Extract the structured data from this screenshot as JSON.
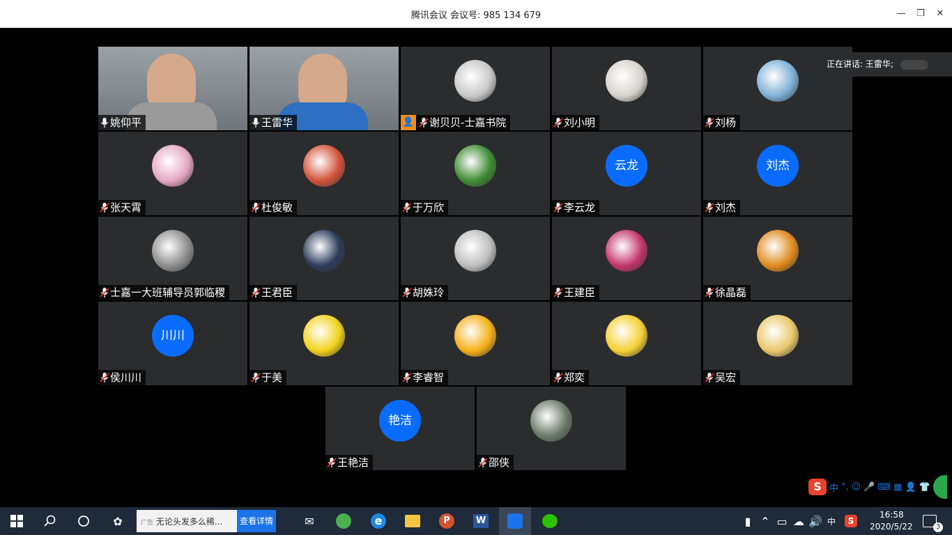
{
  "window": {
    "title": "腾讯会议 会议号: 985 134 679",
    "minimize": "—",
    "restore": "❐",
    "close": "✕"
  },
  "speaking_indicator": "正在讲话: 王雷华;",
  "participants": [
    {
      "name": "姚仰平",
      "type": "video",
      "mic": "on"
    },
    {
      "name": "王雷华",
      "type": "video",
      "mic": "on",
      "active": true
    },
    {
      "name": "谢贝贝-士嘉书院",
      "type": "avatar",
      "mic": "muted",
      "host_icon": true
    },
    {
      "name": "刘小明",
      "type": "avatar",
      "mic": "muted"
    },
    {
      "name": "刘杨",
      "type": "avatar",
      "mic": "muted"
    },
    {
      "name": "张天霄",
      "type": "avatar",
      "mic": "muted"
    },
    {
      "name": "杜俊敏",
      "type": "avatar",
      "mic": "muted"
    },
    {
      "name": "于万欣",
      "type": "avatar",
      "mic": "muted"
    },
    {
      "name": "李云龙",
      "type": "text",
      "avatar_text": "云龙",
      "mic": "muted"
    },
    {
      "name": "刘杰",
      "type": "text",
      "avatar_text": "刘杰",
      "mic": "muted"
    },
    {
      "name": "士嘉一大班辅导员郭临稷",
      "type": "avatar",
      "mic": "muted"
    },
    {
      "name": "王君臣",
      "type": "avatar",
      "mic": "muted"
    },
    {
      "name": "胡姝玲",
      "type": "avatar",
      "mic": "muted"
    },
    {
      "name": "王建臣",
      "type": "avatar",
      "mic": "muted"
    },
    {
      "name": "徐晶磊",
      "type": "avatar",
      "mic": "muted"
    },
    {
      "name": "侯川川",
      "type": "text",
      "avatar_text": "川川",
      "mic": "muted"
    },
    {
      "name": "于美",
      "type": "avatar",
      "mic": "muted"
    },
    {
      "name": "李睿智",
      "type": "avatar",
      "mic": "muted"
    },
    {
      "name": "郑奕",
      "type": "avatar",
      "mic": "muted"
    },
    {
      "name": "吴宏",
      "type": "avatar",
      "mic": "muted"
    },
    {
      "name": "王艳洁",
      "type": "text",
      "avatar_text": "艳洁",
      "mic": "muted"
    },
    {
      "name": "邵侠",
      "type": "avatar",
      "mic": "muted"
    }
  ],
  "ime_bar": {
    "lang": "中",
    "punct": "°,"
  },
  "taskbar": {
    "ad_label": "广告",
    "ad_text": "无论头发多么稀...",
    "ad_button": "查看详情",
    "tray_lang": "中",
    "time": "16:58",
    "date": "2020/5/22",
    "notification_count": "3"
  },
  "colors": {
    "accent": "#0a6cff",
    "active_border": "#4cd964",
    "muted_mic": "#e0332c"
  }
}
